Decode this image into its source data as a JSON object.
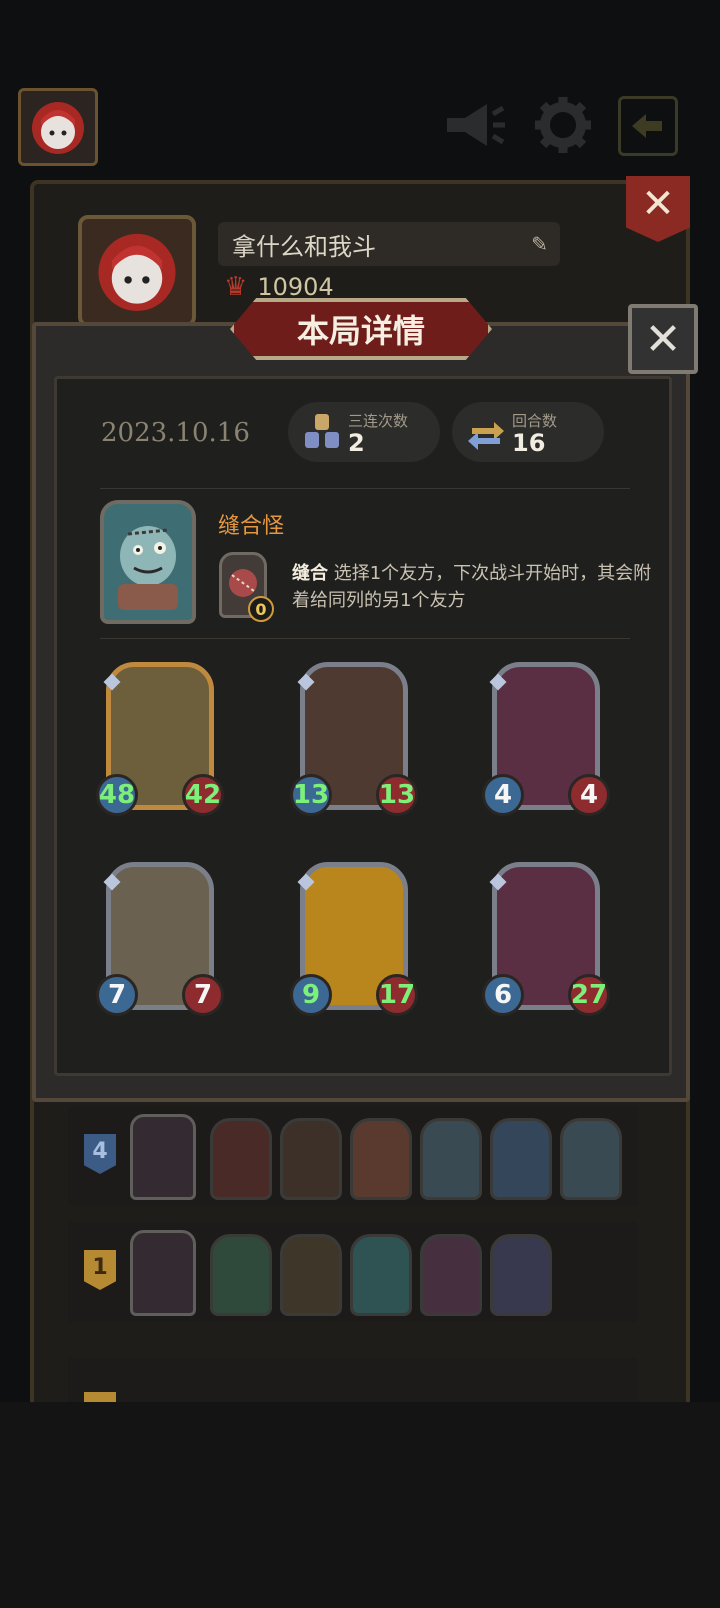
{
  "profile": {
    "name": "拿什么和我斗",
    "score": "10904"
  },
  "modal": {
    "title": "本局详情",
    "date": "2023.10.16",
    "stats": [
      {
        "label": "三连次数",
        "value": "2"
      },
      {
        "label": "回合数",
        "value": "16"
      }
    ],
    "hero": {
      "name": "缝合怪",
      "skill_name": "缝合",
      "skill_desc": "选择1个友方，下次战斗开始时，其会附着给同列的另1个友方",
      "skill_cost": "0"
    },
    "minions": [
      {
        "atk": "48",
        "hp": "42",
        "atk_buffed": true,
        "hp_buffed": true,
        "frame": "gold",
        "color": "#6d5e3c"
      },
      {
        "atk": "13",
        "hp": "13",
        "atk_buffed": true,
        "hp_buffed": true,
        "frame": "silver",
        "color": "#4f3a32"
      },
      {
        "atk": "4",
        "hp": "4",
        "atk_buffed": false,
        "hp_buffed": false,
        "frame": "silver",
        "color": "#5a2f44"
      },
      {
        "atk": "7",
        "hp": "7",
        "atk_buffed": false,
        "hp_buffed": false,
        "frame": "silver",
        "color": "#6a6150"
      },
      {
        "atk": "9",
        "hp": "17",
        "atk_buffed": true,
        "hp_buffed": true,
        "frame": "silver",
        "color": "#b9861e"
      },
      {
        "atk": "6",
        "hp": "27",
        "atk_buffed": false,
        "hp_buffed": true,
        "frame": "silver",
        "color": "#5a2f44"
      }
    ]
  },
  "history": [
    {
      "rank": "4",
      "rank_color": "#3c5c86",
      "rank_text": "#a9bfe0",
      "minions": [
        "#4a2a26",
        "#3d3028",
        "#5a3a2e",
        "#3a4a52",
        "#34465a",
        "#3a4a52"
      ]
    },
    {
      "rank": "1",
      "rank_color": "#b58a32",
      "rank_text": "#3d2a10",
      "minions": [
        "#2f4a3a",
        "#3e3628",
        "#2f5252",
        "#463040",
        "#38384e"
      ]
    }
  ]
}
